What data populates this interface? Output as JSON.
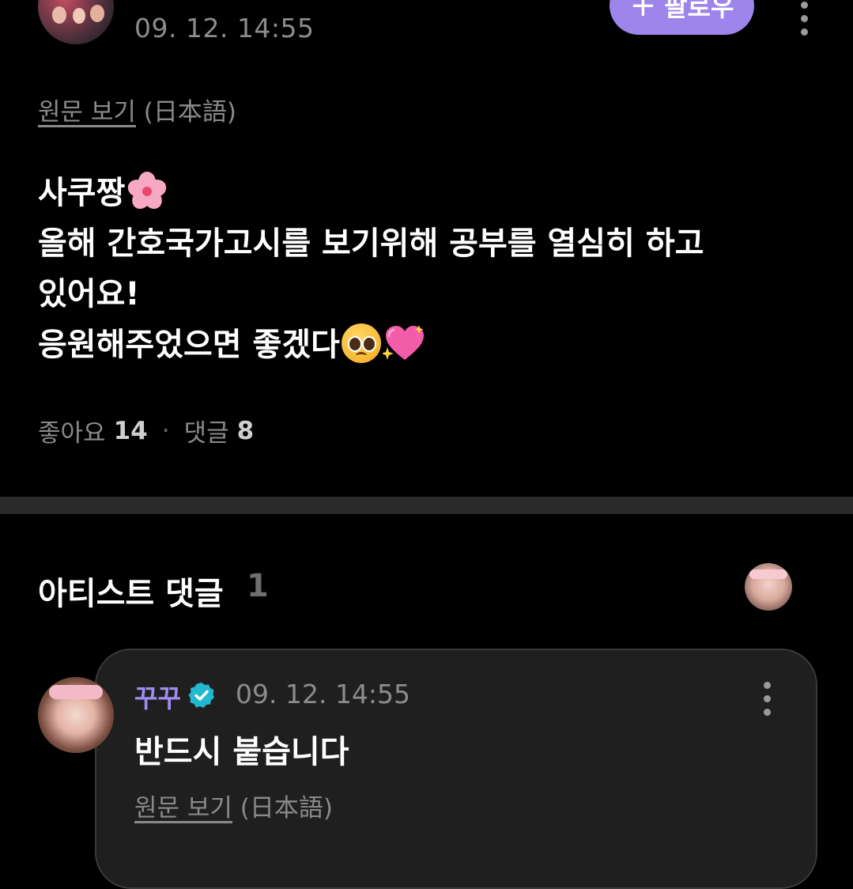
{
  "post": {
    "time": "09. 12. 14:55",
    "follow_label": "팔로우",
    "follow_icon": "plus-icon",
    "translation": {
      "link_label": "원문 보기",
      "language": "(日本語)"
    },
    "body": {
      "line1": "사쿠짱",
      "line2": "올해 간호국가고시를 보기위해 공부를 열심히 하고",
      "line3": "있어요!",
      "line4": "응원해주었으면 좋겠다"
    },
    "emojis": [
      "cherry-blossom",
      "pleading-face",
      "sparkling-heart"
    ],
    "stats": {
      "likes_label": "좋아요",
      "likes_count": "14",
      "separator": "·",
      "comments_label": "댓글",
      "comments_count": "8"
    }
  },
  "artist_comments": {
    "title": "아티스트 댓글",
    "count": "1",
    "comment": {
      "author": "꾸꾸",
      "verified": true,
      "time": "09. 12. 14:55",
      "text": "반드시 붙습니다",
      "translation": {
        "link_label": "원문 보기",
        "language": "(日本語)"
      }
    }
  },
  "colors": {
    "background": "#000000",
    "accent": "#9d85ec",
    "artist_name": "#a08bf0",
    "verified_badge": "#22b8cf",
    "muted_text": "#8c8c8c",
    "card_background": "#1f1f1f"
  }
}
